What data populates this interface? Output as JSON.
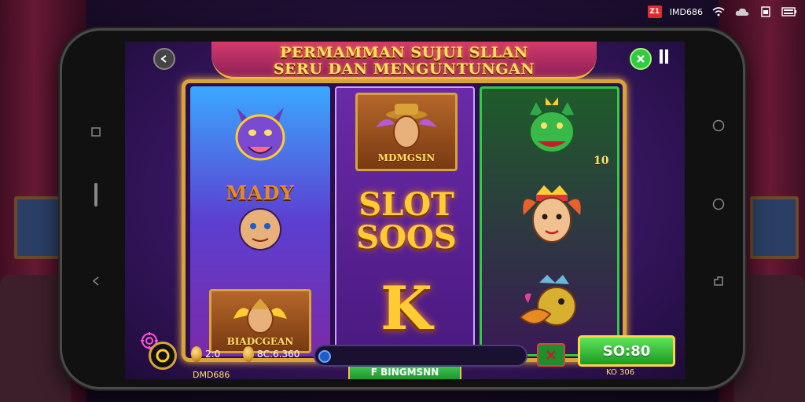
{
  "status_bar": {
    "app_icon_text": "Z1",
    "app_name": "IMD686",
    "icons": [
      "wifi-icon",
      "cloud-icon",
      "sim-icon",
      "battery-icon"
    ]
  },
  "game": {
    "title_line1": "PERMAMMAN SUJUI SLLAN",
    "title_line2": "SERU DAN MENGUNTUNGAN"
  },
  "reels": {
    "reel1": {
      "symbol1": "wolf-head",
      "symbol2_label": "MADY",
      "symbol3_label": "BIADCGEAN"
    },
    "reel2": {
      "symbol1_label": "MDMGSIN",
      "symbol2_line1": "SLOT",
      "symbol2_line2": "SOOS",
      "symbol3": "K"
    },
    "reel3": {
      "symbol1_badge": "10",
      "symbol2": "crowned-face",
      "symbol3": "duck-head"
    }
  },
  "controls": {
    "brand": "DMD686",
    "mode_button": "F BINGMSNN",
    "bet_label": "KO 306",
    "coin1_value": "2:0",
    "coin2_value": "8C:6.360",
    "spin_button": "SO:80"
  },
  "colors": {
    "accent_gold": "#d8a43a",
    "spin_green": "#1b9a22",
    "screen_purple": "#3a1766"
  }
}
